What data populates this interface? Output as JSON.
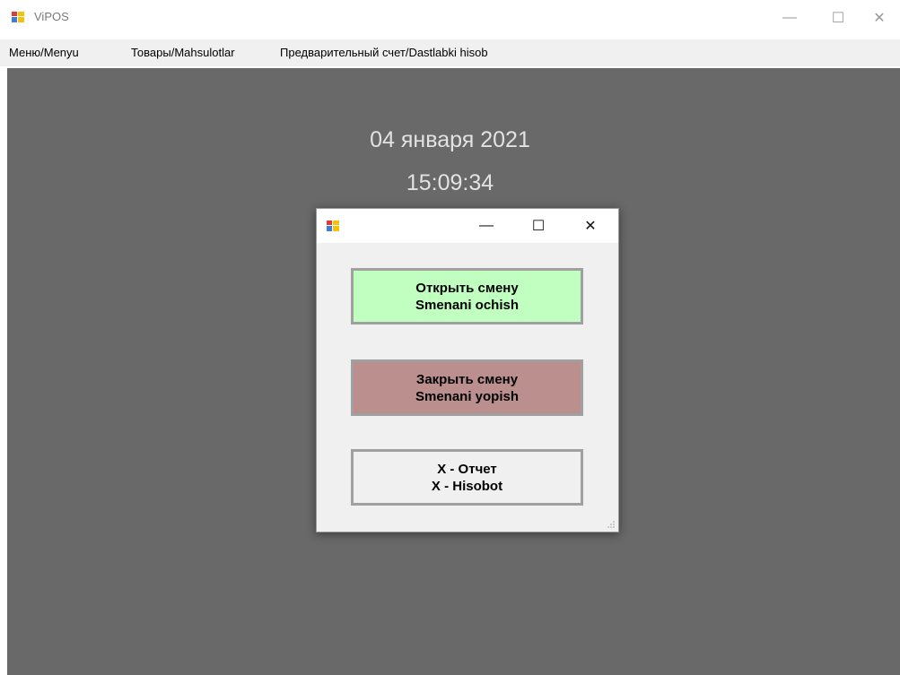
{
  "window": {
    "title": "ViPOS",
    "controls": {
      "minimize": "—",
      "maximize": "☐",
      "close": "✕"
    }
  },
  "menu": {
    "items": [
      {
        "label": "Меню/Menyu"
      },
      {
        "label": "Товары/Mahsulotlar"
      },
      {
        "label": "Предварительный счет/Dastlabki hisob"
      }
    ]
  },
  "clock": {
    "date": "04 января 2021",
    "time": "15:09:34"
  },
  "dialog": {
    "controls": {
      "minimize": "—",
      "maximize": "☐",
      "close": "✕"
    },
    "buttons": [
      {
        "line1": "Открыть смену",
        "line2": "Smenani ochish",
        "color": "#c0ffc0"
      },
      {
        "line1": "Закрыть смену",
        "line2": "Smenani yopish",
        "color": "#bc8f8f"
      },
      {
        "line1": "X - Отчет",
        "line2": "X - Hisobot",
        "color": "#f0f0f0"
      }
    ]
  },
  "colors": {
    "workarea": "#696969",
    "menubar": "#f0f0f0",
    "clock_text": "#e2e2e2"
  }
}
